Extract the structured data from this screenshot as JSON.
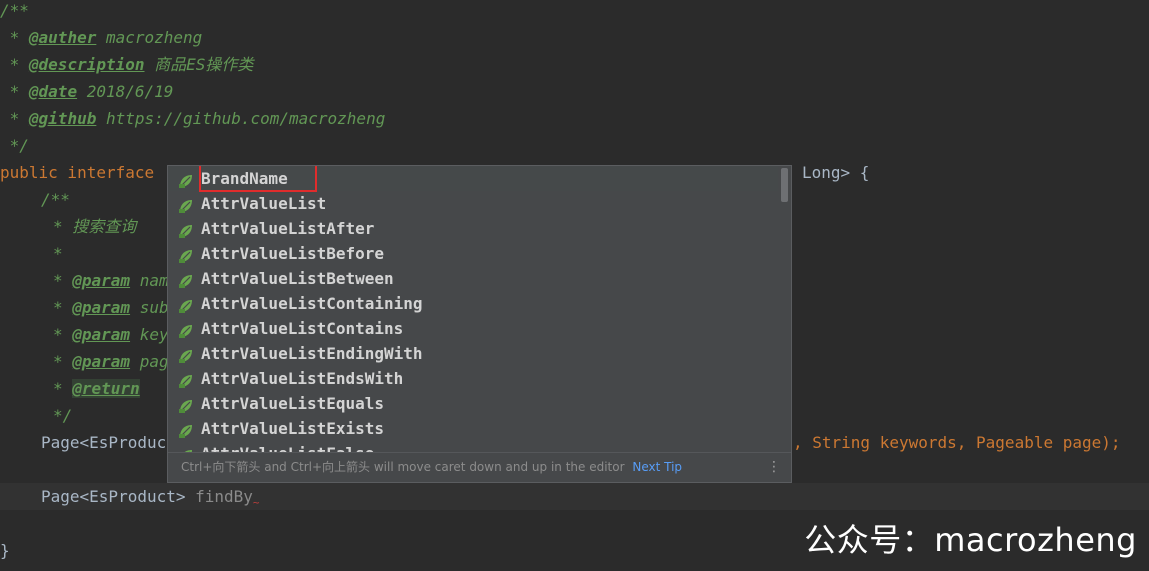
{
  "code": {
    "l1": "/**",
    "l2_tag": "@auther",
    "l2_text": " macrozheng",
    "l3_tag": "@description",
    "l3_text": " 商品ES操作类",
    "l4_tag": "@date",
    "l4_text": " 2018/6/19",
    "l5_tag": "@github",
    "l5_text": " https://github.com/macrozheng",
    "l6": " */",
    "l7_kw": "public interface",
    "l7_tail": "Long> {",
    "l8": "/**",
    "l9": "* 搜索查询",
    "l10": "*",
    "p_star": "* ",
    "p_tag": "@param",
    "p1": " nam",
    "p2": " sub",
    "p3": " key",
    "p4": " pag",
    "ret_tag": "@return",
    "l16": "*/",
    "l17_head": "Page<EsProduc",
    "l17_tail_a": ", String keywords",
    "l17_tail_b": ", Pageable page)",
    "l17_tail_c": ";",
    "l19_head": "Page<EsProduct> ",
    "l19_typed": "findBy",
    "squiggle": "~",
    "close": "}"
  },
  "completion": {
    "items": [
      "BrandName",
      "AttrValueList",
      "AttrValueListAfter",
      "AttrValueListBefore",
      "AttrValueListBetween",
      "AttrValueListContaining",
      "AttrValueListContains",
      "AttrValueListEndingWith",
      "AttrValueListEndsWith",
      "AttrValueListEquals",
      "AttrValueListExists",
      "AttrValueListFalse"
    ],
    "selected_index": 0,
    "footer_text": "Ctrl+向下箭头 and Ctrl+向上箭头 will move caret down and up in the editor",
    "next_tip": "Next Tip",
    "menu_glyph": "⋮",
    "icon": "spring-leaf-icon"
  },
  "watermark": "公众号：macrozheng",
  "colors": {
    "editor_bg": "#2b2b2b",
    "comment": "#629755",
    "keyword": "#cc7832",
    "selection_outline": "#e02c2c",
    "popup_bg": "#46484a",
    "link": "#589df6"
  }
}
